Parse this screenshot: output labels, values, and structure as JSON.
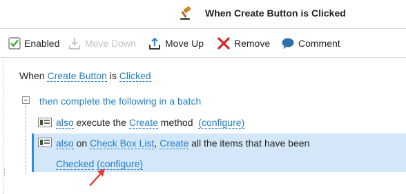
{
  "header": {
    "title": "When Create Button is Clicked",
    "icon": "gavel-icon"
  },
  "toolbar": {
    "items": [
      {
        "label": "Enabled",
        "icon": "checkbox-checked-icon",
        "enabled": true
      },
      {
        "label": "Move Down",
        "icon": "move-down-icon",
        "enabled": false
      },
      {
        "label": "Move Up",
        "icon": "move-up-icon",
        "enabled": true
      },
      {
        "label": "Remove",
        "icon": "red-x-icon",
        "enabled": true
      },
      {
        "label": "Comment",
        "icon": "speech-bubble-icon",
        "enabled": true
      }
    ]
  },
  "rule": {
    "when": "When",
    "trigger": "Create Button",
    "is": "is",
    "event": "Clicked",
    "batch": "then complete the following in a batch",
    "actions": [
      {
        "also": "also",
        "text1": "execute the",
        "target": "Create",
        "text2": "method",
        "configure": "(configure)"
      },
      {
        "also": "also",
        "on": "on",
        "target": "Check Box List",
        "comma": ",",
        "verb": "Create",
        "text": "all the items that have been",
        "state": "Checked",
        "configure": "(configure)",
        "selected": true
      }
    ]
  },
  "colors": {
    "link": "#1e7ec8",
    "selection": "#d4e7f9",
    "selection_border": "#2f8ae5",
    "arrow": "#e53935"
  }
}
